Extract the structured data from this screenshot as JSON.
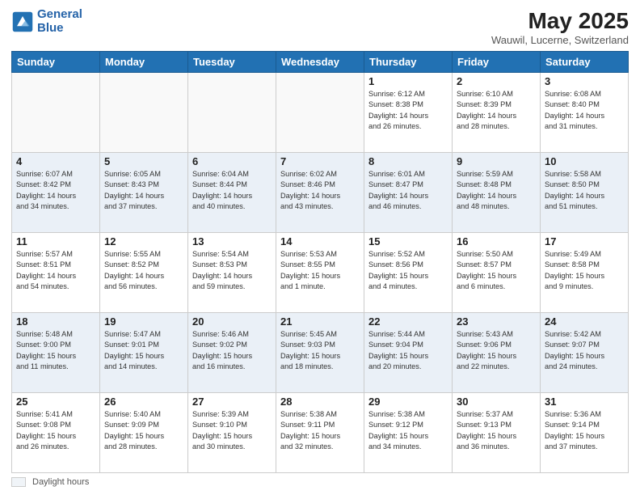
{
  "header": {
    "logo_line1": "General",
    "logo_line2": "Blue",
    "title": "May 2025",
    "subtitle": "Wauwil, Lucerne, Switzerland"
  },
  "footer": {
    "daylight_label": "Daylight hours"
  },
  "days_of_week": [
    "Sunday",
    "Monday",
    "Tuesday",
    "Wednesday",
    "Thursday",
    "Friday",
    "Saturday"
  ],
  "weeks": [
    [
      {
        "day": "",
        "info": ""
      },
      {
        "day": "",
        "info": ""
      },
      {
        "day": "",
        "info": ""
      },
      {
        "day": "",
        "info": ""
      },
      {
        "day": "1",
        "info": "Sunrise: 6:12 AM\nSunset: 8:38 PM\nDaylight: 14 hours\nand 26 minutes."
      },
      {
        "day": "2",
        "info": "Sunrise: 6:10 AM\nSunset: 8:39 PM\nDaylight: 14 hours\nand 28 minutes."
      },
      {
        "day": "3",
        "info": "Sunrise: 6:08 AM\nSunset: 8:40 PM\nDaylight: 14 hours\nand 31 minutes."
      }
    ],
    [
      {
        "day": "4",
        "info": "Sunrise: 6:07 AM\nSunset: 8:42 PM\nDaylight: 14 hours\nand 34 minutes."
      },
      {
        "day": "5",
        "info": "Sunrise: 6:05 AM\nSunset: 8:43 PM\nDaylight: 14 hours\nand 37 minutes."
      },
      {
        "day": "6",
        "info": "Sunrise: 6:04 AM\nSunset: 8:44 PM\nDaylight: 14 hours\nand 40 minutes."
      },
      {
        "day": "7",
        "info": "Sunrise: 6:02 AM\nSunset: 8:46 PM\nDaylight: 14 hours\nand 43 minutes."
      },
      {
        "day": "8",
        "info": "Sunrise: 6:01 AM\nSunset: 8:47 PM\nDaylight: 14 hours\nand 46 minutes."
      },
      {
        "day": "9",
        "info": "Sunrise: 5:59 AM\nSunset: 8:48 PM\nDaylight: 14 hours\nand 48 minutes."
      },
      {
        "day": "10",
        "info": "Sunrise: 5:58 AM\nSunset: 8:50 PM\nDaylight: 14 hours\nand 51 minutes."
      }
    ],
    [
      {
        "day": "11",
        "info": "Sunrise: 5:57 AM\nSunset: 8:51 PM\nDaylight: 14 hours\nand 54 minutes."
      },
      {
        "day": "12",
        "info": "Sunrise: 5:55 AM\nSunset: 8:52 PM\nDaylight: 14 hours\nand 56 minutes."
      },
      {
        "day": "13",
        "info": "Sunrise: 5:54 AM\nSunset: 8:53 PM\nDaylight: 14 hours\nand 59 minutes."
      },
      {
        "day": "14",
        "info": "Sunrise: 5:53 AM\nSunset: 8:55 PM\nDaylight: 15 hours\nand 1 minute."
      },
      {
        "day": "15",
        "info": "Sunrise: 5:52 AM\nSunset: 8:56 PM\nDaylight: 15 hours\nand 4 minutes."
      },
      {
        "day": "16",
        "info": "Sunrise: 5:50 AM\nSunset: 8:57 PM\nDaylight: 15 hours\nand 6 minutes."
      },
      {
        "day": "17",
        "info": "Sunrise: 5:49 AM\nSunset: 8:58 PM\nDaylight: 15 hours\nand 9 minutes."
      }
    ],
    [
      {
        "day": "18",
        "info": "Sunrise: 5:48 AM\nSunset: 9:00 PM\nDaylight: 15 hours\nand 11 minutes."
      },
      {
        "day": "19",
        "info": "Sunrise: 5:47 AM\nSunset: 9:01 PM\nDaylight: 15 hours\nand 14 minutes."
      },
      {
        "day": "20",
        "info": "Sunrise: 5:46 AM\nSunset: 9:02 PM\nDaylight: 15 hours\nand 16 minutes."
      },
      {
        "day": "21",
        "info": "Sunrise: 5:45 AM\nSunset: 9:03 PM\nDaylight: 15 hours\nand 18 minutes."
      },
      {
        "day": "22",
        "info": "Sunrise: 5:44 AM\nSunset: 9:04 PM\nDaylight: 15 hours\nand 20 minutes."
      },
      {
        "day": "23",
        "info": "Sunrise: 5:43 AM\nSunset: 9:06 PM\nDaylight: 15 hours\nand 22 minutes."
      },
      {
        "day": "24",
        "info": "Sunrise: 5:42 AM\nSunset: 9:07 PM\nDaylight: 15 hours\nand 24 minutes."
      }
    ],
    [
      {
        "day": "25",
        "info": "Sunrise: 5:41 AM\nSunset: 9:08 PM\nDaylight: 15 hours\nand 26 minutes."
      },
      {
        "day": "26",
        "info": "Sunrise: 5:40 AM\nSunset: 9:09 PM\nDaylight: 15 hours\nand 28 minutes."
      },
      {
        "day": "27",
        "info": "Sunrise: 5:39 AM\nSunset: 9:10 PM\nDaylight: 15 hours\nand 30 minutes."
      },
      {
        "day": "28",
        "info": "Sunrise: 5:38 AM\nSunset: 9:11 PM\nDaylight: 15 hours\nand 32 minutes."
      },
      {
        "day": "29",
        "info": "Sunrise: 5:38 AM\nSunset: 9:12 PM\nDaylight: 15 hours\nand 34 minutes."
      },
      {
        "day": "30",
        "info": "Sunrise: 5:37 AM\nSunset: 9:13 PM\nDaylight: 15 hours\nand 36 minutes."
      },
      {
        "day": "31",
        "info": "Sunrise: 5:36 AM\nSunset: 9:14 PM\nDaylight: 15 hours\nand 37 minutes."
      }
    ]
  ]
}
